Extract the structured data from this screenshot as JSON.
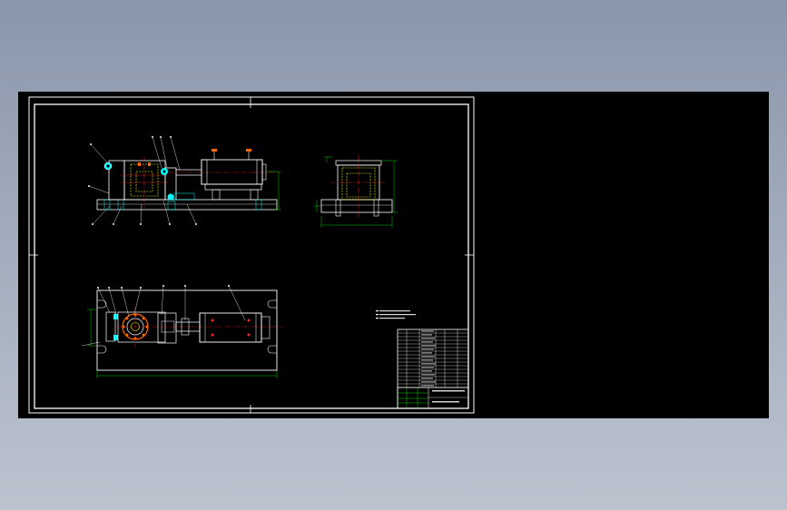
{
  "drawing": {
    "colors": {
      "background": "#000000",
      "frame": "#ffffff",
      "outline": "#ffffff",
      "dimension": "#00ff00",
      "hidden": "#ffff00",
      "section": "#ff2020",
      "center": "#ff2020",
      "accent": "#00ffff",
      "part_fill": "#ff6600"
    },
    "technical_notes": {
      "title": "",
      "lines": [
        "",
        "",
        ""
      ]
    },
    "title_block": {
      "company": "",
      "drawing_name": "",
      "scale": ""
    }
  }
}
